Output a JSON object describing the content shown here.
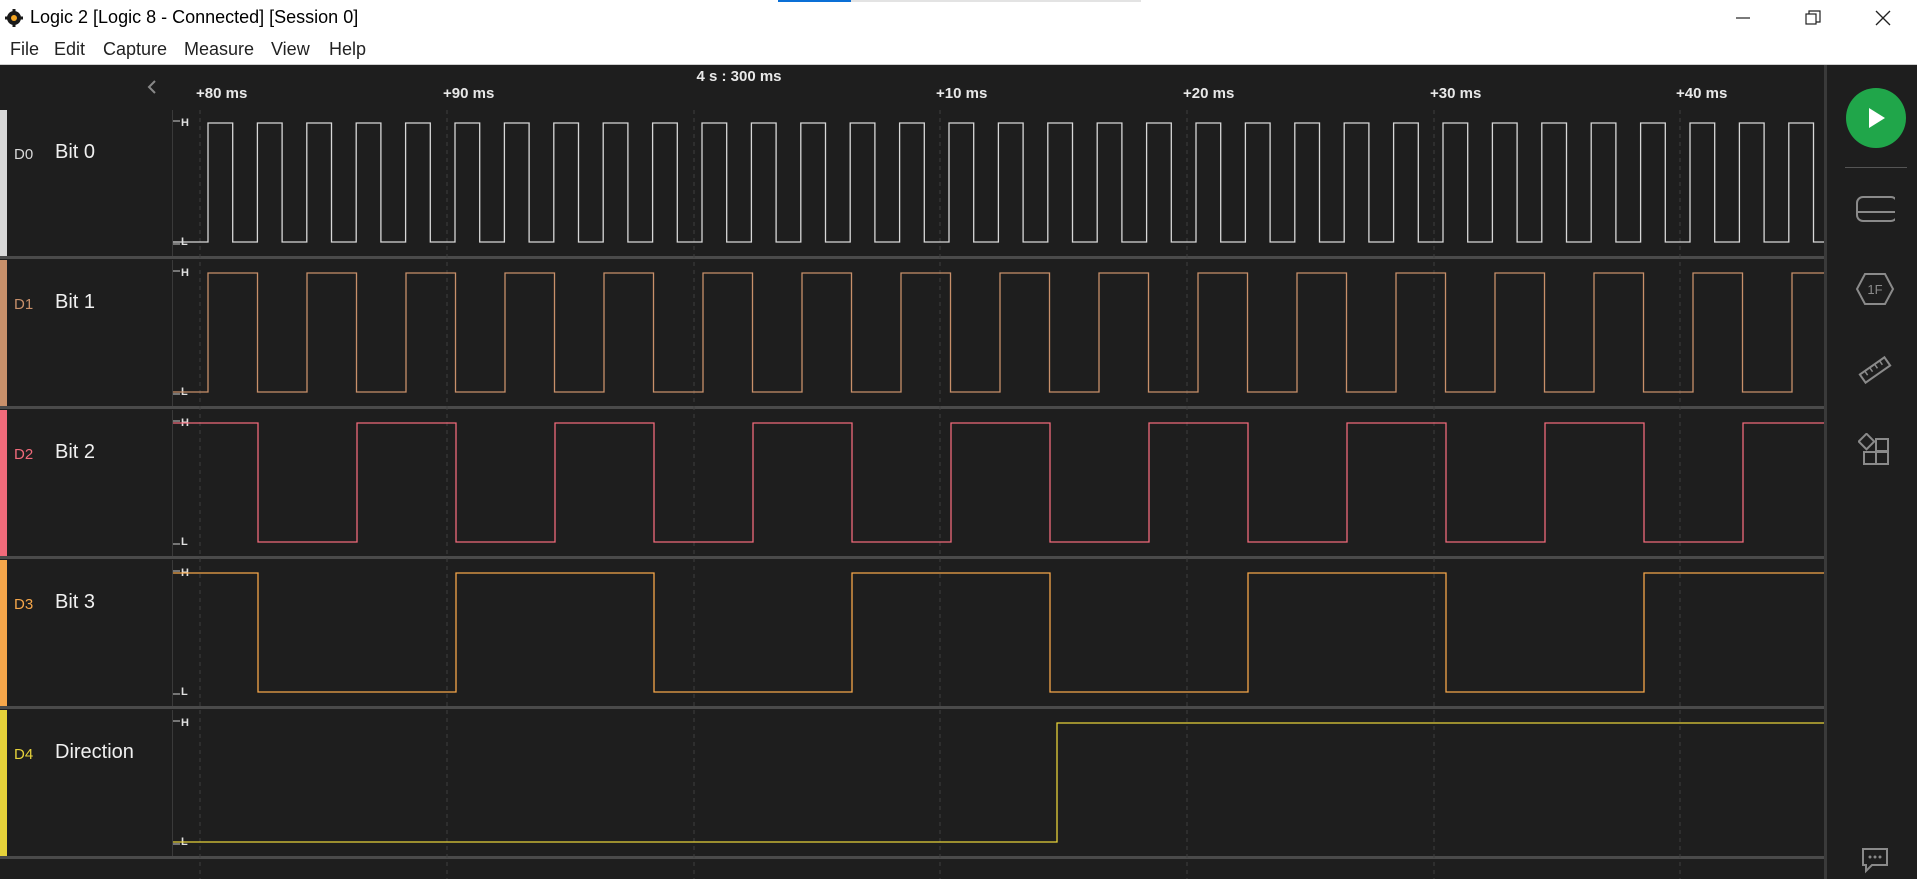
{
  "window": {
    "title": "Logic 2 [Logic 8 - Connected] [Session 0]",
    "minimize_icon": "minimize-icon",
    "maximize_icon": "restore-icon",
    "close_icon": "close-icon"
  },
  "menu": {
    "items": [
      "File",
      "Edit",
      "Capture",
      "Measure",
      "View",
      "Help"
    ]
  },
  "ruler": {
    "center_label": "4 s : 300 ms",
    "ticks": [
      "+80 ms",
      "+90 ms",
      "+10 ms",
      "+20 ms",
      "+30 ms",
      "+40 ms"
    ]
  },
  "channels": [
    {
      "id": "D0",
      "name": "Bit 0",
      "color": "#d8d8d8",
      "high_label": "H",
      "low_label": "L"
    },
    {
      "id": "D1",
      "name": "Bit 1",
      "color": "#c8906a",
      "high_label": "H",
      "low_label": "L"
    },
    {
      "id": "D2",
      "name": "Bit 2",
      "color": "#f06a7a",
      "high_label": "H",
      "low_label": "L"
    },
    {
      "id": "D3",
      "name": "Bit 3",
      "color": "#f5a64a",
      "high_label": "H",
      "low_label": "L"
    },
    {
      "id": "D4",
      "name": "Direction",
      "color": "#e6d23a",
      "high_label": "H",
      "low_label": "L"
    }
  ],
  "sidebar": {
    "play_icon": "play-icon",
    "buttons": [
      "device-icon",
      "analyzer-icon",
      "measure-ruler-icon",
      "extensions-icon",
      "chat-icon"
    ],
    "analyzer_badge": "1F"
  },
  "colors": {
    "accent_green": "#20a64a",
    "background": "#1e1e1e"
  }
}
